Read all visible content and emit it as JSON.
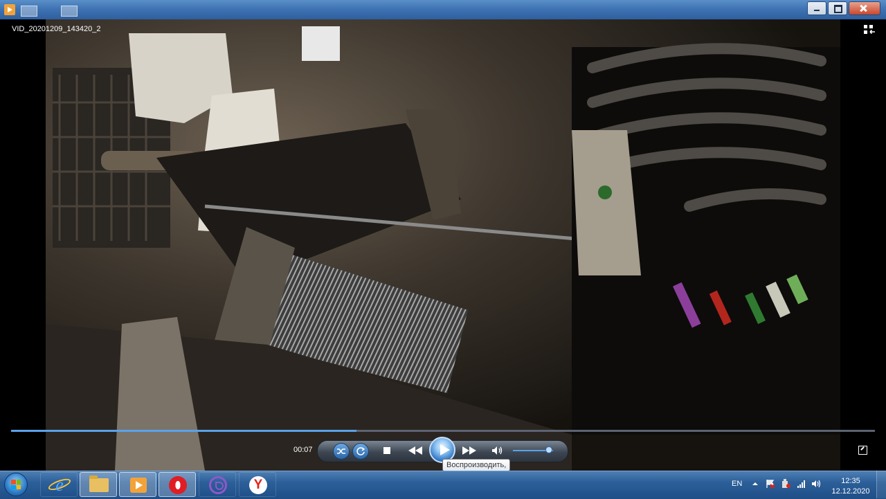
{
  "window": {
    "title": ""
  },
  "video": {
    "filename": "VID_20201209_143420_2"
  },
  "player": {
    "elapsed": "00:07",
    "progress_fraction": 0.4,
    "volume_fraction": 0.9,
    "tooltip": "Воспроизводить,"
  },
  "taskbar": {
    "pinned": [
      "internet-explorer-icon",
      "folder-icon",
      "media-player-icon",
      "opera-icon",
      "viber-icon",
      "yandex-icon"
    ],
    "yandex_glyph": "Y"
  },
  "tray": {
    "language": "EN",
    "time": "12:35",
    "date": "12.12.2020"
  },
  "colors": {
    "accent": "#5aa2ea",
    "titlebar": "#3f74b4",
    "taskbar": "#2c5f99"
  }
}
